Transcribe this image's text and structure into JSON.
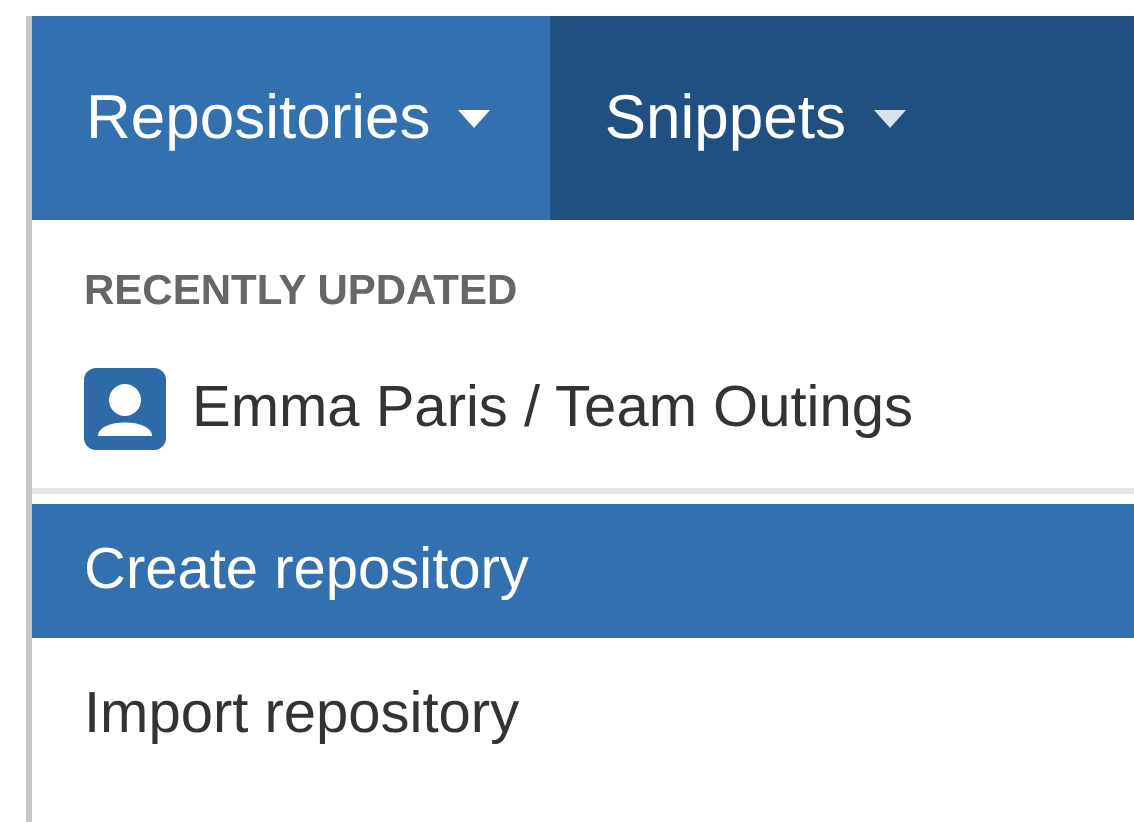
{
  "nav": {
    "tabs": [
      {
        "label": "Repositories",
        "selected": true
      },
      {
        "label": "Snippets",
        "selected": false
      }
    ]
  },
  "dropdown": {
    "section_heading": "RECENTLY UPDATED",
    "recent": [
      {
        "label": "Emma Paris / Team Outings"
      }
    ],
    "actions": [
      {
        "label": "Create repository",
        "selected": true
      },
      {
        "label": "Import repository",
        "selected": false
      }
    ]
  }
}
